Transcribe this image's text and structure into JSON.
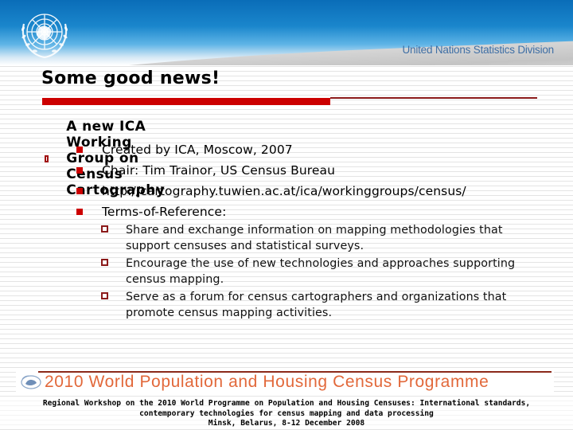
{
  "header": {
    "logo": "un-emblem-icon",
    "division": "United Nations Statistics Division"
  },
  "slide": {
    "title": "Some good news!",
    "main_point": {
      "bullet": "hollow-square-bullet",
      "text": "A new ICA Working Group on Census Cartography",
      "sub_points": [
        {
          "bullet": "filled-square-bullet",
          "text": "Created by ICA, Moscow, 2007"
        },
        {
          "bullet": "filled-square-bullet",
          "text": "Chair: Tim Trainor, US Census Bureau"
        },
        {
          "bullet": "filled-square-bullet",
          "text": "http://cartography.tuwien.ac.at/ica/workinggroups/census/"
        },
        {
          "bullet": "filled-square-bullet",
          "text": "Terms-of-Reference:"
        }
      ],
      "terms_of_reference": [
        {
          "bullet": "hollow-square-bullet",
          "text": "Share and exchange information on mapping methodologies that support censuses and statistical surveys."
        },
        {
          "bullet": "hollow-square-bullet",
          "text": "Encourage the use of new technologies and approaches supporting census mapping."
        },
        {
          "bullet": "hollow-square-bullet",
          "text": "Serve as a forum for census cartographers and organizations that promote census mapping activities."
        }
      ]
    }
  },
  "banner": {
    "logo": "census-programme-logo-icon",
    "text": "2010 World Population and Housing Census Programme"
  },
  "footer": {
    "line1": "Regional Workshop on the 2010 World Programme on Population and Housing Censuses: International standards,",
    "line2": "contemporary technologies for census mapping and data processing",
    "line3": "Minsk, Belarus, 8-12 December 2008"
  },
  "colors": {
    "accent_red": "#cc0000",
    "header_blue": "#0a6db8",
    "division_text": "#3f6fa5",
    "banner_orange": "#e2683a"
  }
}
